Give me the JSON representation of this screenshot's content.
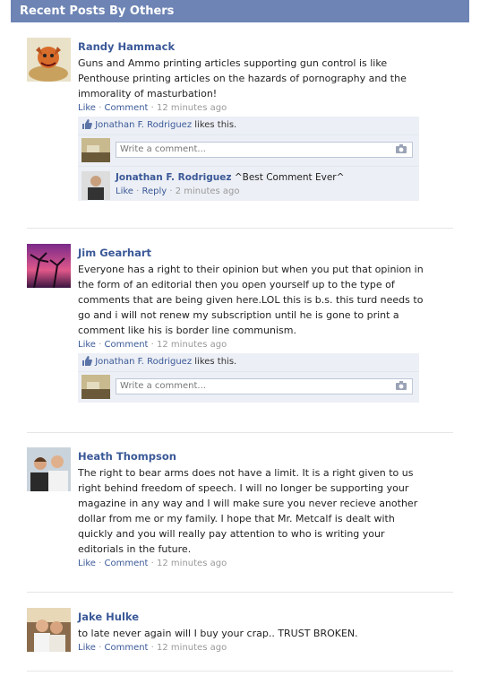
{
  "header": {
    "title": "Recent Posts By Others"
  },
  "common": {
    "like": "Like",
    "comment": "Comment",
    "reply": "Reply",
    "sep": " · ",
    "likes_this": "likes this.",
    "write_comment": "Write a comment..."
  },
  "posts": [
    {
      "name": "Randy Hammack",
      "text": "Guns and Ammo printing articles supporting gun control is like Penthouse printing articles on the hazards of pornography and the immorality of masturbation!",
      "time": "12 minutes ago",
      "liker": "Jonathan F. Rodriguez",
      "reply": {
        "name": "Jonathan F. Rodriguez",
        "text": "^Best Comment Ever^",
        "time": "2 minutes ago"
      }
    },
    {
      "name": "Jim Gearhart",
      "text": "Everyone has a right to their opinion but when you put that opinion in the form of an editorial then you open yourself up to the type of comments that are being given here.LOL this is b.s. this turd needs to go and i will not renew my subscription until he is gone to print a comment like his is border line communism.",
      "time": "12 minutes ago",
      "liker": "Jonathan F. Rodriguez"
    },
    {
      "name": "Heath Thompson",
      "text": "The right to bear arms does not have a limit. It is a right given to us right behind freedom of speech. I will no longer be supporting your magazine in any way and I will make sure you never recieve another dollar from me or my family. I hope that Mr. Metcalf is dealt with quickly and you will really pay attention to who is writing your editorials in the future.",
      "time": "12 minutes ago"
    },
    {
      "name": "Jake Hulke",
      "text": "to late never again will I buy your crap.. TRUST BROKEN.",
      "time": "12 minutes ago"
    }
  ]
}
